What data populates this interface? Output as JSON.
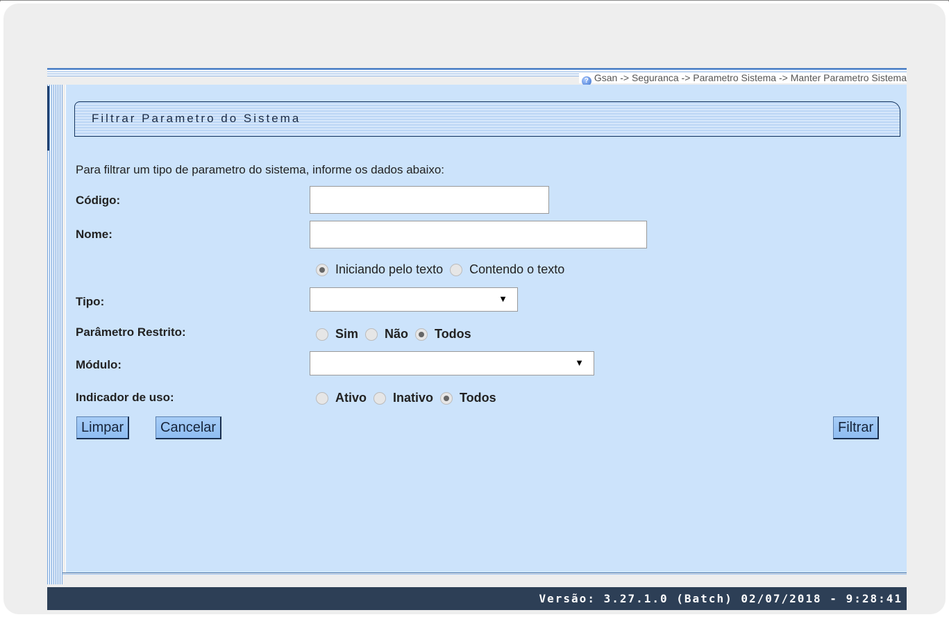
{
  "breadcrumb": "Gsan -> Seguranca -> Parametro Sistema -> Manter Parametro Sistema",
  "title": "Filtrar Parametro do Sistema",
  "intro": "Para filtrar um tipo de parametro do sistema, informe os dados abaixo:",
  "fields": {
    "codigo": {
      "label": "Código:",
      "value": ""
    },
    "nome": {
      "label": "Nome:",
      "value": ""
    },
    "nome_mode": {
      "options": [
        "Iniciando pelo texto",
        "Contendo o texto"
      ],
      "selected": "Iniciando pelo texto"
    },
    "tipo": {
      "label": "Tipo:",
      "value": ""
    },
    "parametro_restrito": {
      "label": "Parâmetro Restrito:",
      "options": [
        "Sim",
        "Não",
        "Todos"
      ],
      "selected": "Todos"
    },
    "modulo": {
      "label": "Módulo:",
      "value": ""
    },
    "indicador_uso": {
      "label": "Indicador de uso:",
      "options": [
        "Ativo",
        "Inativo",
        "Todos"
      ],
      "selected": "Todos"
    }
  },
  "buttons": {
    "limpar": "Limpar",
    "cancelar": "Cancelar",
    "filtrar": "Filtrar"
  },
  "footer": "Versão: 3.27.1.0 (Batch) 02/07/2018 - 9:28:41",
  "icons": {
    "help": "help-icon",
    "dropdown": "dropdown-arrow-icon"
  },
  "colors": {
    "panel_background": "#cce3fb",
    "footer_background": "#2d3f56",
    "button_background": "#a7cdf7"
  }
}
